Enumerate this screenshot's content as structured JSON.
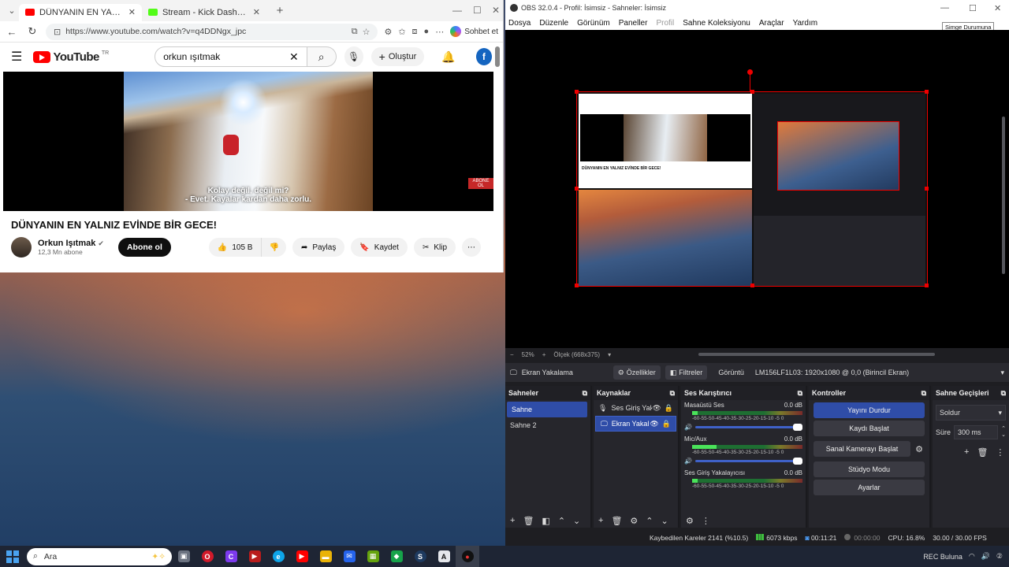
{
  "browser": {
    "tabs": [
      {
        "title": "DÜNYANIN EN YALNIZ EVİNDE BİR",
        "active": true,
        "favicon_color": "#ff0000"
      },
      {
        "title": "Stream - Kick Dashboard",
        "active": false,
        "favicon_color": "#53fc18"
      }
    ],
    "url": "https://www.youtube.com/watch?v=q4DDNgx_jpc",
    "copilot_label": "Sohbet et"
  },
  "youtube": {
    "logo": "YouTube",
    "region": "TR",
    "search_value": "orkun ışıtmak",
    "create_label": "Oluştur",
    "avatar_letter": "f",
    "subtitle_line1": "Kolay değil, değil mi?",
    "subtitle_line2": "- Evet. Kayalar kardan daha zorlu.",
    "corner_badge": "ABONE OL",
    "video_title": "DÜNYANIN EN YALNIZ EVİNDE BİR GECE!",
    "channel_name": "Orkun Işıtmak",
    "channel_subs": "12,3 Mn abone",
    "subscribe_label": "Abone ol",
    "likes": "105 B",
    "share_label": "Paylaş",
    "save_label": "Kaydet",
    "clip_label": "Klip"
  },
  "obs": {
    "title": "OBS 32.0.4 - Profil: İsimsiz - Sahneler: İsimsiz",
    "tooltip": "Simge Durumuna",
    "menu": [
      "Dosya",
      "Düzenle",
      "Görünüm",
      "Paneller",
      "Profil",
      "Sahne Koleksiyonu",
      "Araçlar",
      "Yardım"
    ],
    "zoom": "52%",
    "scale": "Ölçek (668x375)",
    "source_toolbar": {
      "source": "Ekran Yakalama",
      "properties": "Özellikler",
      "filters": "Filtreler",
      "display_label": "Görüntü",
      "display_value": "LM156LF1L03: 1920x1080 @ 0,0 (Birincil Ekran)"
    },
    "docks": {
      "scenes_title": "Sahneler",
      "scenes": [
        "Sahne",
        "Sahne 2"
      ],
      "sources_title": "Kaynaklar",
      "sources": [
        "Ses Giriş Yakı",
        "Ekran Yakalı"
      ],
      "mixer_title": "Ses Karıştırıcı",
      "mixer": [
        {
          "name": "Masaüstü Ses",
          "db": "0.0 dB",
          "level": 0.05
        },
        {
          "name": "Mic/Aux",
          "db": "0.0 dB",
          "level": 0.22
        },
        {
          "name": "Ses Giriş Yakalayıcısı",
          "db": "0.0 dB",
          "level": 0.05
        }
      ],
      "meter_scale": "-60-55-50-45-40-35-30-25-20-15-10 -5  0",
      "controls_title": "Kontroller",
      "controls": {
        "stop_stream": "Yayını Durdur",
        "start_record": "Kaydı Başlat",
        "virtual_cam": "Sanal Kamerayı Başlat",
        "studio_mode": "Stüdyo Modu",
        "settings": "Ayarlar"
      },
      "transitions_title": "Sahne Geçişleri",
      "transition": "Soldur",
      "duration_label": "Süre",
      "duration": "300 ms"
    },
    "status": {
      "dropped": "Kaybedilen Kareler 2141 (%10.5)",
      "bitrate": "6073 kbps",
      "stream_time": "00:11:21",
      "rec_time": "00:00:00",
      "cpu": "CPU: 16.8%",
      "fps": "30.00 / 30.00 FPS"
    }
  },
  "taskbar": {
    "search_placeholder": "Ara",
    "apps": [
      {
        "name": "task-view",
        "color": "#6b7280",
        "glyph": "▣"
      },
      {
        "name": "opera",
        "color": "#d11a2a",
        "glyph": "O"
      },
      {
        "name": "copilot",
        "color": "#7c3aed",
        "glyph": "C"
      },
      {
        "name": "capcut",
        "color": "#b91c1c",
        "glyph": "▶"
      },
      {
        "name": "edge",
        "color": "#0ea5e9",
        "glyph": "e"
      },
      {
        "name": "youtube",
        "color": "#ff0000",
        "glyph": "▶"
      },
      {
        "name": "file-explorer",
        "color": "#eab308",
        "glyph": "▬"
      },
      {
        "name": "mail",
        "color": "#2563eb",
        "glyph": "✉"
      },
      {
        "name": "minecraft",
        "color": "#65a30d",
        "glyph": "▦"
      },
      {
        "name": "xbox-app",
        "color": "#16a34a",
        "glyph": "◆"
      },
      {
        "name": "steam",
        "color": "#1e3a5f",
        "glyph": "S"
      },
      {
        "name": "capture-app",
        "color": "#e5e7eb",
        "glyph": "A"
      },
      {
        "name": "obs",
        "color": "#111111",
        "glyph": "●"
      }
    ],
    "tray_text": "REC Buluna"
  }
}
